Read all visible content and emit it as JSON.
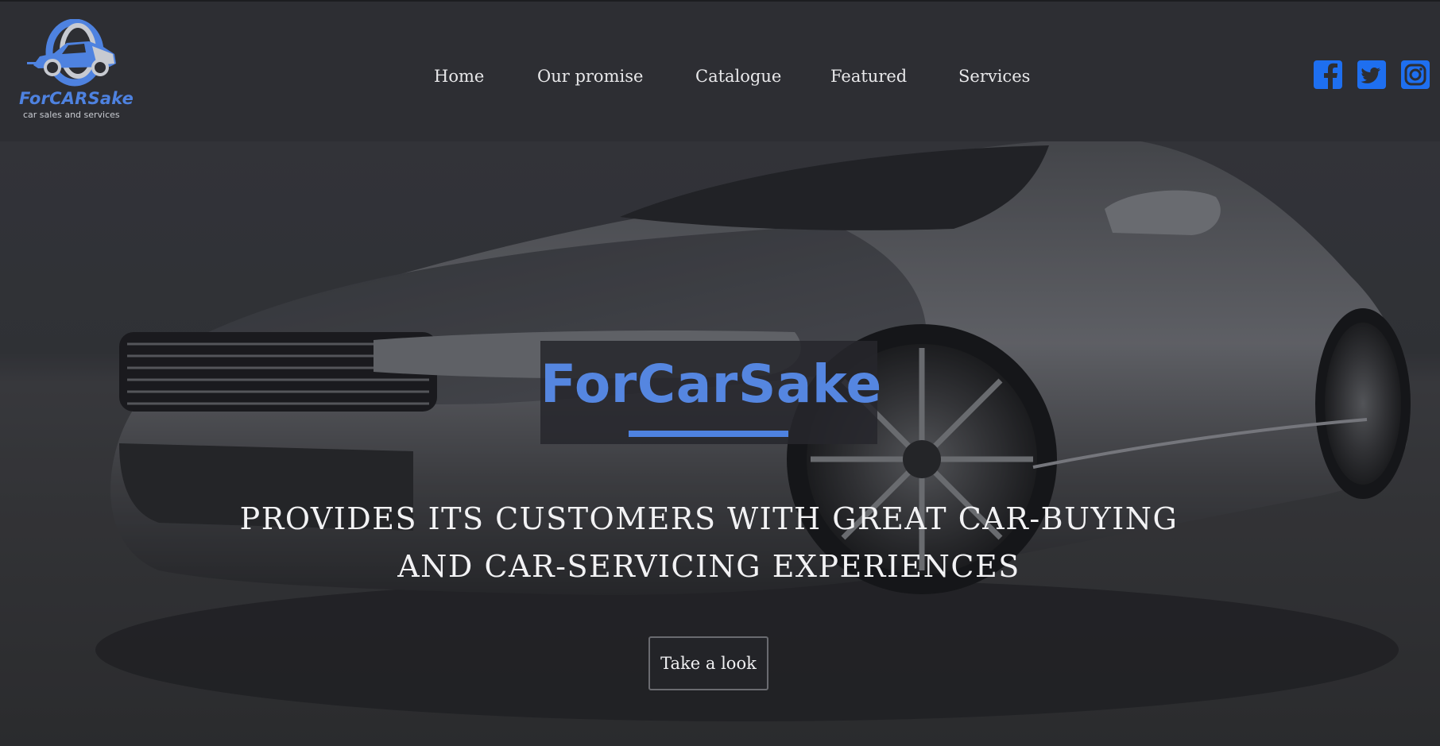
{
  "brand": {
    "logo_name": "ForCARSake",
    "logo_tagline": "car sales and services"
  },
  "nav": {
    "items": [
      {
        "label": "Home"
      },
      {
        "label": "Our promise"
      },
      {
        "label": "Catalogue"
      },
      {
        "label": "Featured"
      },
      {
        "label": "Services"
      }
    ]
  },
  "social": {
    "icons": [
      "facebook-icon",
      "twitter-icon",
      "instagram-icon"
    ],
    "color": "#1e6ff0"
  },
  "hero": {
    "title": "ForCarSake",
    "tagline_line1": "PROVIDES ITS CUSTOMERS WITH GREAT CAR-BUYING",
    "tagline_line2": "AND CAR-SERVICING EXPERIENCES",
    "cta_label": "Take a look",
    "background_image": "silver sports car"
  },
  "colors": {
    "accent": "#4e82e0",
    "header_bg": "#2d2e33",
    "text": "#e8e8ea"
  }
}
